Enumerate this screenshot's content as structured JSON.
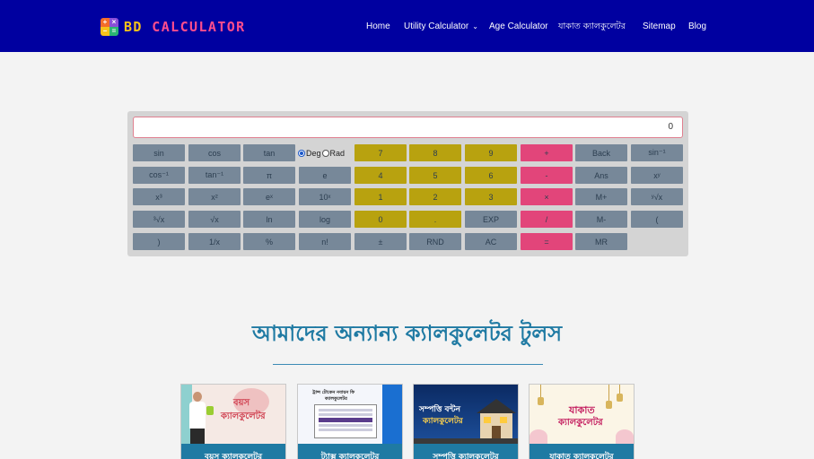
{
  "header": {
    "brand_bd": "BD",
    "brand_rest": " CALCULATOR",
    "nav": [
      {
        "label": "Home"
      },
      {
        "label": "Utility Calculator"
      },
      {
        "label": "Age Calculator"
      },
      {
        "label": "যাকাত ক্যালকুলেটর"
      },
      {
        "label": "Sitemap"
      },
      {
        "label": "Blog"
      }
    ]
  },
  "calculator": {
    "display_value": "0",
    "angle_mode": {
      "deg_label": "Deg",
      "rad_label": "Rad",
      "selected": "Deg"
    },
    "buttons": {
      "sin": "sin",
      "cos": "cos",
      "tan": "tan",
      "seven": "7",
      "eight": "8",
      "nine": "9",
      "plus": "+",
      "back": "Back",
      "asin": "sin⁻¹",
      "acos": "cos⁻¹",
      "atan": "tan⁻¹",
      "pi": "π",
      "e": "e",
      "four": "4",
      "five": "5",
      "six": "6",
      "minus": "-",
      "ans": "Ans",
      "pow": "xʸ",
      "cube": "x³",
      "square": "x²",
      "exp_e": "eˣ",
      "ten_pow": "10ˣ",
      "one": "1",
      "two": "2",
      "three": "3",
      "times": "×",
      "mplus": "M+",
      "yroot": "ʸ√x",
      "cuberoot": "³√x",
      "sqrt": "√x",
      "ln": "ln",
      "log": "log",
      "zero": "0",
      "dot": ".",
      "EXP": "EXP",
      "divide": "/",
      "mminus": "M-",
      "lparen": "(",
      "rparen": ")",
      "recip": "1/x",
      "percent": "%",
      "fact": "n!",
      "plusminus": "±",
      "rnd": "RND",
      "ac": "AC",
      "equals": "=",
      "mr": "MR"
    }
  },
  "tools": {
    "title": "আমাদের অন্যান্য ক্যালকুলেটর টুলস",
    "cards": [
      {
        "label": "বয়স ক্যালকুলেটর",
        "thumb_line1": "বয়স",
        "thumb_line2": "ক্যালকুলেটর"
      },
      {
        "label": "ট্যাক্স ক্যালকুলেটর",
        "thumb_line1": "ট্রান্স টোকেন নবায়ন ফি",
        "thumb_line2": "ক্যালকুলেটর"
      },
      {
        "label": "সম্পত্তি ক্যালকুলেটর",
        "thumb_line1": "সম্পত্তি বন্টন",
        "thumb_line2": "ক্যালকুলেটর"
      },
      {
        "label": "যাকাত ক্যালকুলেটর",
        "thumb_line1": "যাকাত",
        "thumb_line2": "ক্যালকুলেটর"
      }
    ]
  },
  "colors": {
    "header_bg": "#0000a0",
    "accent": "#1f7aa3",
    "btn_gray": "#778899",
    "btn_yellow": "#b8a20f",
    "btn_pink": "#e2457a"
  }
}
